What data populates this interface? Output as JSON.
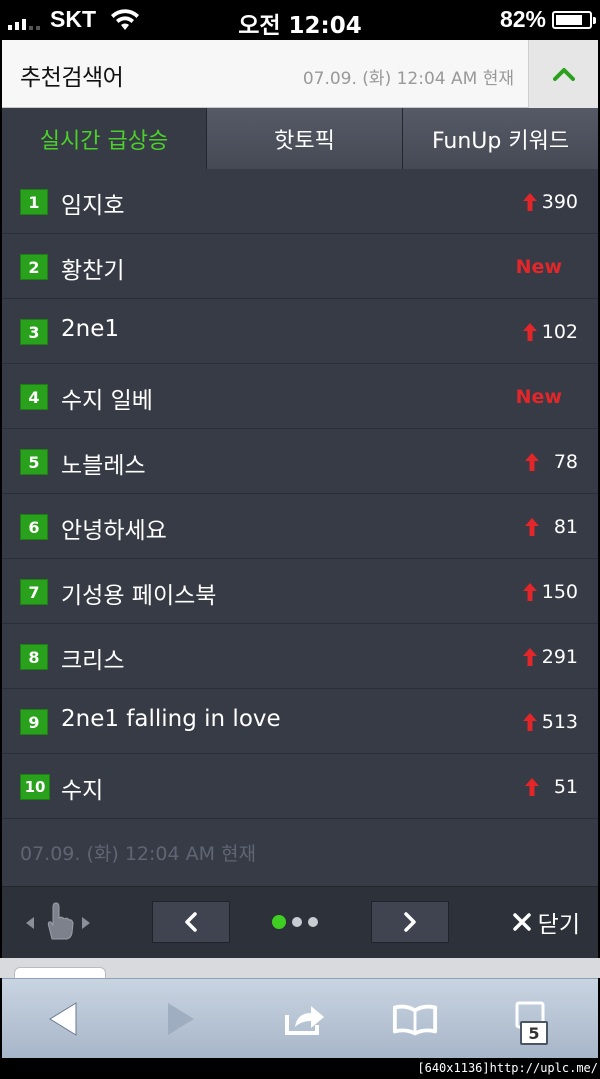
{
  "status_bar": {
    "carrier": "SKT",
    "time": "오전 12:04",
    "battery_percent_text": "82%",
    "battery_level": 0.82
  },
  "header": {
    "title": "추천검색어",
    "timestamp": "07.09. (화) 12:04 AM 현재",
    "accent_color": "#2aa11c"
  },
  "tabs": [
    {
      "label": "실시간 급상승",
      "active": true
    },
    {
      "label": "핫토픽",
      "active": false
    },
    {
      "label": "FunUp 키워드",
      "active": false
    }
  ],
  "keywords": [
    {
      "rank": "1",
      "keyword": "임지호",
      "change": "390",
      "is_new": false
    },
    {
      "rank": "2",
      "keyword": "황찬기",
      "change": "New",
      "is_new": true
    },
    {
      "rank": "3",
      "keyword": "2ne1",
      "change": "102",
      "is_new": false
    },
    {
      "rank": "4",
      "keyword": "수지 일베",
      "change": "New",
      "is_new": true
    },
    {
      "rank": "5",
      "keyword": "노블레스",
      "change": "78",
      "is_new": false
    },
    {
      "rank": "6",
      "keyword": "안녕하세요",
      "change": "81",
      "is_new": false
    },
    {
      "rank": "7",
      "keyword": "기성용 페이스북",
      "change": "150",
      "is_new": false
    },
    {
      "rank": "8",
      "keyword": "크리스",
      "change": "291",
      "is_new": false
    },
    {
      "rank": "9",
      "keyword": "2ne1 falling in love",
      "change": "513",
      "is_new": false
    },
    {
      "rank": "10",
      "keyword": "수지",
      "change": "51",
      "is_new": false
    }
  ],
  "footer": {
    "timestamp": "07.09. (화) 12:04 AM 현재",
    "page_count": 3,
    "current_page": 1,
    "close_label": "닫기"
  },
  "browser_toolbar": {
    "open_pages": "5"
  },
  "watermark": "[640x1136]http://uplc.me/"
}
